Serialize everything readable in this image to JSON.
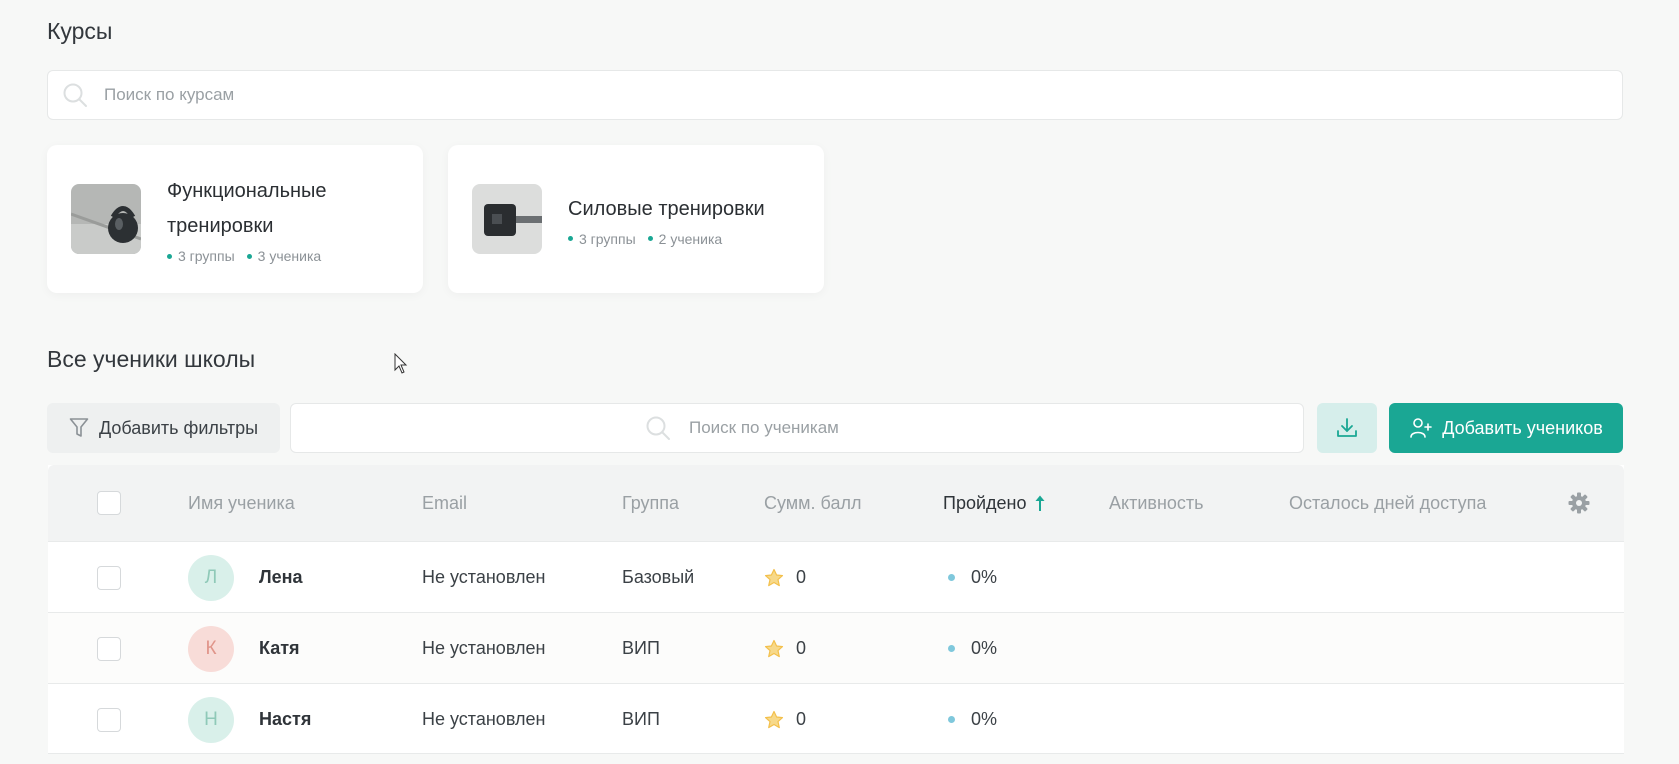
{
  "courses": {
    "title": "Курсы",
    "search_placeholder": "Поиск по курсам",
    "items": [
      {
        "name_line1": "Функциональные",
        "name_line2": "тренировки",
        "groups": "3 группы",
        "students": "3 ученика"
      },
      {
        "name_line1": "Силовые тренировки",
        "name_line2": "",
        "groups": "3 группы",
        "students": "2 ученика"
      }
    ]
  },
  "students": {
    "title": "Все ученики школы",
    "filter_label": "Добавить фильтры",
    "search_placeholder": "Поиск по ученикам",
    "add_label": "Добавить учеников",
    "columns": {
      "name": "Имя ученика",
      "email": "Email",
      "group": "Группа",
      "score": "Сумм. балл",
      "completed": "Пройдено",
      "activity": "Активность",
      "days_left": "Осталось дней доступа"
    },
    "rows": [
      {
        "initial": "Л",
        "name": "Лена",
        "email": "Не установлен",
        "group": "Базовый",
        "score": "0",
        "completed": "0%",
        "avatar_bg": "#d9f0ea",
        "avatar_fg": "#8fc9b8"
      },
      {
        "initial": "К",
        "name": "Катя",
        "email": "Не установлен",
        "group": "ВИП",
        "score": "0",
        "completed": "0%",
        "avatar_bg": "#f8dcd8",
        "avatar_fg": "#e0958a"
      },
      {
        "initial": "Н",
        "name": "Настя",
        "email": "Не установлен",
        "group": "ВИП",
        "score": "0",
        "completed": "0%",
        "avatar_bg": "#d9f0ea",
        "avatar_fg": "#8fc9b8"
      }
    ]
  },
  "colors": {
    "accent": "#1aa794",
    "accent_light": "#d6eeeb",
    "star": "#f3c04c"
  },
  "icons": [
    "search-icon",
    "filter-icon",
    "download-icon",
    "add-user-icon",
    "sort-up-icon",
    "gear-icon",
    "star-icon",
    "cursor-icon"
  ]
}
